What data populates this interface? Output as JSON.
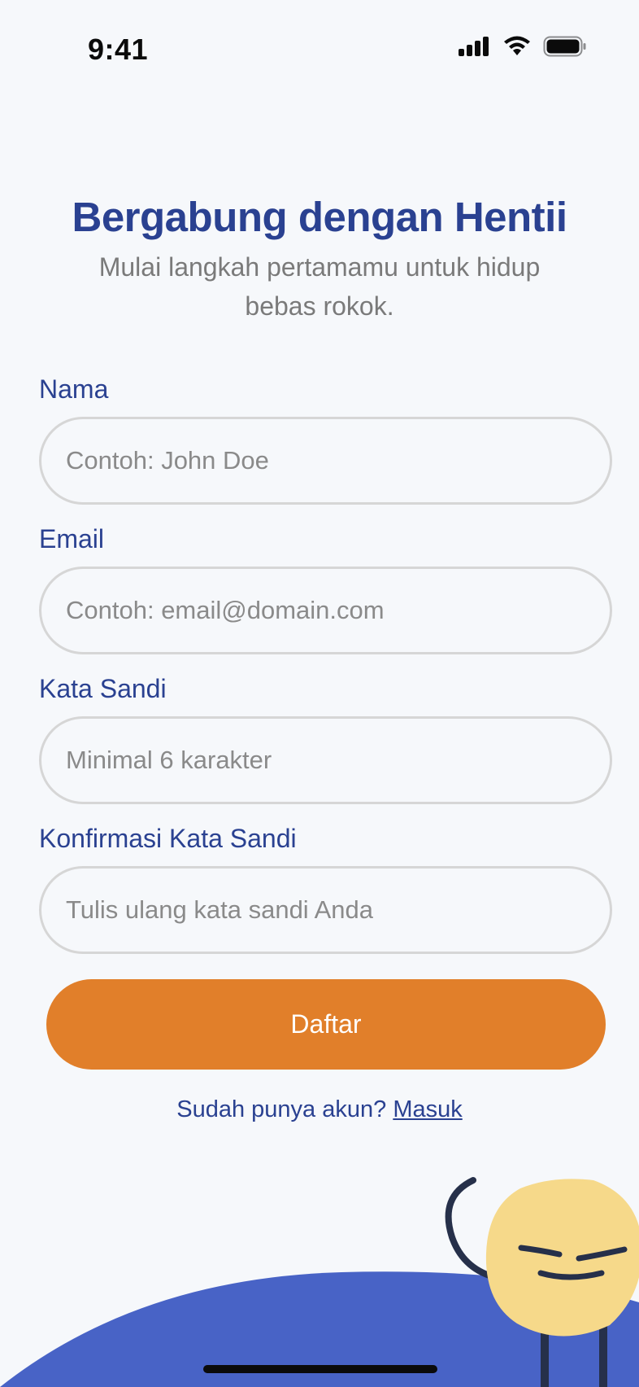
{
  "status_bar": {
    "time": "9:41"
  },
  "header": {
    "title": "Bergabung dengan Hentii",
    "subtitle": "Mulai langkah pertamamu untuk hidup bebas rokok."
  },
  "form": {
    "name": {
      "label": "Nama",
      "placeholder": "Contoh: John Doe",
      "value": ""
    },
    "email": {
      "label": "Email",
      "placeholder": "Contoh: email@domain.com",
      "value": ""
    },
    "password": {
      "label": "Kata Sandi",
      "placeholder": "Minimal 6 karakter",
      "value": ""
    },
    "confirm_password": {
      "label": "Konfirmasi Kata Sandi",
      "placeholder": "Tulis ulang kata sandi Anda",
      "value": ""
    },
    "submit_label": "Daftar"
  },
  "footer": {
    "prompt": "Sudah punya akun?",
    "link": "Masuk"
  },
  "colors": {
    "primary": "#2A4191",
    "accent": "#E17F2A",
    "background": "#F6F8FB",
    "wave": "#4863C6",
    "mascot": "#F6D98A"
  }
}
